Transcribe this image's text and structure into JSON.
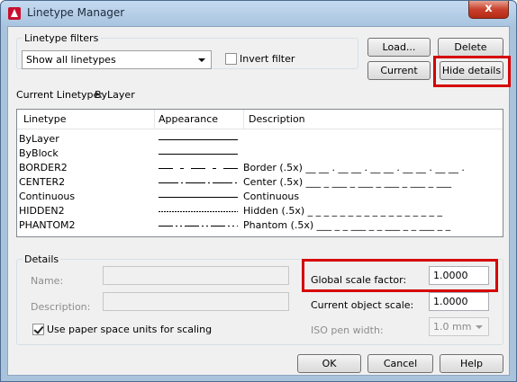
{
  "window": {
    "title": "Linetype Manager",
    "close_glyph": "x"
  },
  "filters": {
    "group_label": "Linetype filters",
    "selected": "Show all linetypes",
    "invert_label": "Invert filter",
    "invert_checked": false
  },
  "buttons": {
    "load": "Load...",
    "delete": "Delete",
    "current": "Current",
    "hide_details": "Hide details",
    "ok": "OK",
    "cancel": "Cancel",
    "help": "Help"
  },
  "current_linetype": {
    "label": "Current Linetype:",
    "value": "ByLayer"
  },
  "list": {
    "columns": [
      "Linetype",
      "Appearance",
      "Description"
    ],
    "rows": [
      {
        "name": "ByLayer",
        "style": "solid",
        "description": ""
      },
      {
        "name": "ByBlock",
        "style": "solid",
        "description": ""
      },
      {
        "name": "BORDER2",
        "style": "border2",
        "description": "Border (.5x) __ __ . __ __ . __ __ . __ __ . __ __ ."
      },
      {
        "name": "CENTER2",
        "style": "center2",
        "description": "Center (.5x) ___ _ ___ _ ___ _ ___ _ ___ _ ___"
      },
      {
        "name": "Continuous",
        "style": "solid",
        "description": "Continuous"
      },
      {
        "name": "HIDDEN2",
        "style": "hidden2",
        "description": "Hidden (.5x) _ _ _ _ _ _ _ _ _ _ _ _ _ _ _ _ _"
      },
      {
        "name": "PHANTOM2",
        "style": "phantom2",
        "description": "Phantom (.5x) ___ _ _ ___ _ _ ___ _ _ ___ _ _"
      }
    ]
  },
  "details": {
    "group_label": "Details",
    "name_label": "Name:",
    "name_value": "",
    "description_label": "Description:",
    "description_value": "",
    "paper_space_label": "Use paper space units for scaling",
    "paper_space_checked": true,
    "global_scale_label": "Global scale factor:",
    "global_scale_value": "1.0000",
    "current_object_scale_label": "Current object scale:",
    "current_object_scale_value": "1.0000",
    "iso_pen_label": "ISO pen width:",
    "iso_pen_value": "1.0 mm"
  },
  "colors": {
    "highlight": "#d60000",
    "title_bar": "#a9c4e0",
    "dialog_bg": "#f0f0f0"
  }
}
